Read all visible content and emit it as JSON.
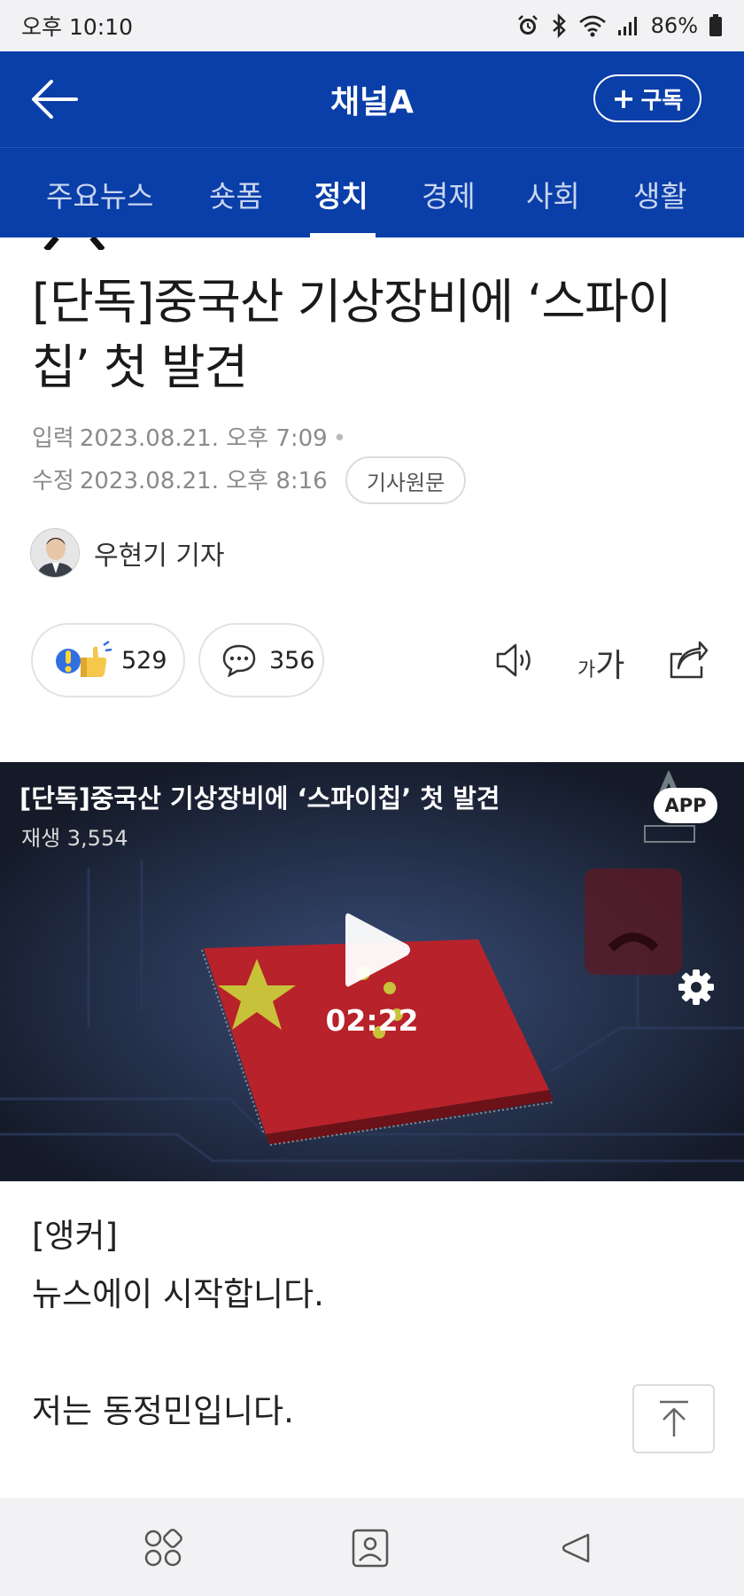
{
  "status_bar": {
    "time": "오후 10:10",
    "battery": "86%"
  },
  "header": {
    "title": "채널A",
    "subscribe_label": "구독"
  },
  "tabs": [
    {
      "label": "주요뉴스",
      "active": false
    },
    {
      "label": "숏폼",
      "active": false
    },
    {
      "label": "정치",
      "active": true
    },
    {
      "label": "경제",
      "active": false
    },
    {
      "label": "사회",
      "active": false
    },
    {
      "label": "생활",
      "active": false
    }
  ],
  "article": {
    "headline": "[단독]중국산 기상장비에 ‘스파이칩’ 첫 발견",
    "input_label": "입력",
    "input_datetime": "2023.08.21. 오후 7:09",
    "edit_label": "수정",
    "edit_datetime": "2023.08.21. 오후 8:16",
    "original_button": "기사원문",
    "author": "우현기 기자",
    "like_count": "529",
    "comment_count": "356",
    "font_small": "가",
    "font_big": "가"
  },
  "video": {
    "title": "[단독]중국산 기상장비에 ‘스파이칩’ 첫 발견",
    "views": "재생 3,554",
    "badge": "APP",
    "duration": "02:22"
  },
  "body": {
    "line1": "[앵커]",
    "line2": "뉴스에이 시작합니다.",
    "line3": "저는 동정민입니다."
  },
  "colors": {
    "brand_blue": "#0a3ea8",
    "tab_inactive": "#c9d6f0"
  },
  "icons": [
    "back-arrow-icon",
    "alarm-icon",
    "bluetooth-icon",
    "wifi-icon",
    "signal-icon",
    "battery-icon",
    "plus-icon",
    "like-reaction-icon",
    "comment-icon",
    "speaker-icon",
    "share-icon",
    "play-icon",
    "settings-icon",
    "scroll-top-icon",
    "recent-apps-icon",
    "home-icon",
    "back-icon"
  ]
}
